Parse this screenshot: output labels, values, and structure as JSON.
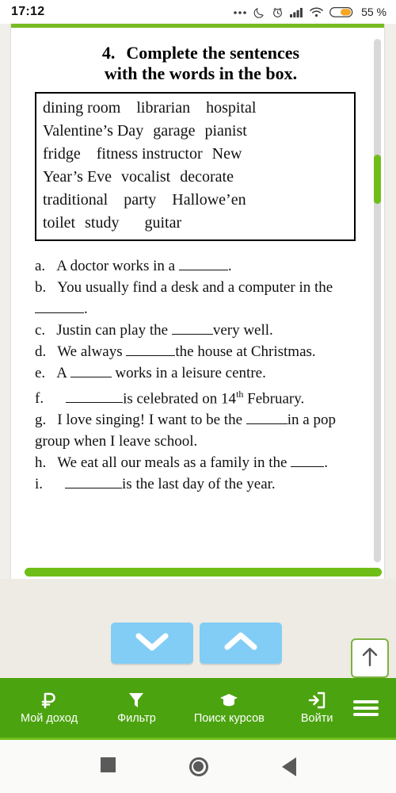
{
  "statusbar": {
    "time": "17:12",
    "battery_percent": "55 %",
    "icons": [
      "more-dots-icon",
      "moon-icon",
      "alarm-icon",
      "signal-icon",
      "wifi-icon",
      "battery-icon"
    ]
  },
  "exercise": {
    "number": "4.",
    "title": "Complete the sentences with the words in the box.",
    "title_line1": "Complete the sentences",
    "title_line2": "with the words in the box.",
    "wordbox": {
      "rows": [
        [
          "dining room",
          "librarian",
          "hospital"
        ],
        [
          "Valentine’s Day",
          "garage",
          "pianist"
        ],
        [
          "fridge",
          "fitness instructor",
          "New"
        ],
        [
          "Year’s Eve",
          "vocalist",
          "decorate"
        ],
        [
          "traditional",
          "party",
          "Hallowe’en"
        ],
        [
          "toilet",
          "study",
          "guitar"
        ]
      ],
      "words": [
        "dining room",
        "librarian",
        "hospital",
        "Valentine’s Day",
        "garage",
        "pianist",
        "fridge",
        "fitness instructor",
        "New Year’s Eve",
        "vocalist",
        "decorate",
        "traditional",
        "party",
        "Hallowe’en",
        "toilet",
        "study",
        "guitar"
      ]
    },
    "questions": [
      {
        "label": "a.",
        "before": "A doctor works in a ",
        "after": "."
      },
      {
        "label": "b.",
        "before": "You usually find a desk and a computer in the ",
        "after": "."
      },
      {
        "label": "c.",
        "before": "Justin can play the ",
        "after": "very well."
      },
      {
        "label": "d.",
        "before": "We always ",
        "after": "the house at Christmas."
      },
      {
        "label": "e.",
        "before": "A ",
        "after": " works in a leisure centre."
      },
      {
        "label": "f.",
        "before": "",
        "after": "is celebrated on 14",
        "sup": "th",
        "tail": " February."
      },
      {
        "label": "g.",
        "before": "I love singing! I want to be the ",
        "after": "in a pop group when I leave school."
      },
      {
        "label": "h.",
        "before": "We eat all our meals as a family in the ",
        "after": "."
      },
      {
        "label": "i.",
        "before": "",
        "after": "is the last day of the year."
      }
    ]
  },
  "controls": {
    "scroll_down": "chevron-down",
    "scroll_up": "chevron-up",
    "to_top": "arrow-up"
  },
  "bottomnav": {
    "items": [
      {
        "label": "Мой доход",
        "icon": "ruble-icon"
      },
      {
        "label": "Фильтр",
        "icon": "funnel-icon"
      },
      {
        "label": "Поиск курсов",
        "icon": "graduation-cap-icon"
      },
      {
        "label": "Войти",
        "icon": "login-icon"
      }
    ],
    "menu": "hamburger-menu"
  },
  "androidnav": {
    "recents": "square-recents",
    "home": "circle-home",
    "back": "triangle-back"
  },
  "colors": {
    "brand_green": "#4ca310",
    "accent_green": "#6fbe17",
    "button_blue": "#82cdf5",
    "page_bg": "#edebe3",
    "battery_orange": "#f5a623"
  }
}
